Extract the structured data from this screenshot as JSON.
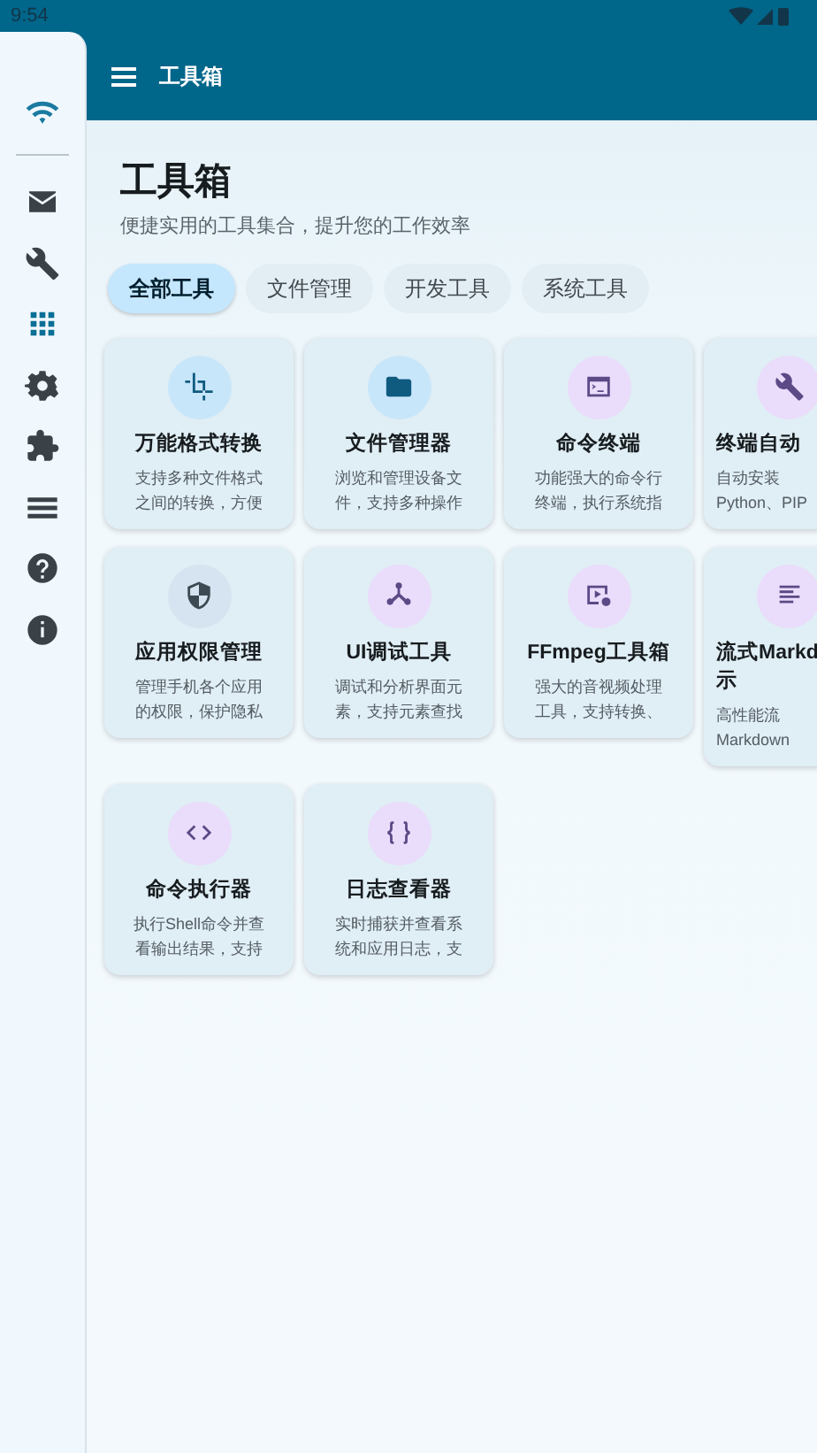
{
  "status_bar": {
    "time": "9:54"
  },
  "sidebar": {
    "items": [
      {
        "selected": false,
        "kind": "logo"
      },
      {
        "selected": false,
        "kind": "item"
      },
      {
        "selected": false,
        "kind": "item"
      },
      {
        "selected": true,
        "kind": "item"
      },
      {
        "selected": false,
        "kind": "item"
      },
      {
        "selected": false,
        "kind": "item"
      },
      {
        "selected": false,
        "kind": "item"
      },
      {
        "selected": false,
        "kind": "item"
      },
      {
        "selected": false,
        "kind": "item"
      }
    ]
  },
  "app_bar": {
    "title": "工具箱"
  },
  "header": {
    "title": "工具箱",
    "subtitle": "便捷实用的工具集合，提升您的工作效率"
  },
  "chips": [
    {
      "label": "全部工具",
      "selected": true
    },
    {
      "label": "文件管理",
      "selected": false
    },
    {
      "label": "开发工具",
      "selected": false
    },
    {
      "label": "系统工具",
      "selected": false
    }
  ],
  "tools": [
    {
      "kind": "full",
      "title_lines": [
        "万能格式转换"
      ],
      "desc_lines": [
        "支持多种文件格式",
        "之间的转换，方便"
      ]
    },
    {
      "kind": "full",
      "title_lines": [
        "文件管理器"
      ],
      "desc_lines": [
        "浏览和管理设备文",
        "件，支持多种操作"
      ]
    },
    {
      "kind": "full",
      "title_lines": [
        "命令终端"
      ],
      "desc_lines": [
        "功能强大的命令行",
        "终端，执行系统指"
      ]
    },
    {
      "kind": "partial",
      "title_lines": [
        "终端自动"
      ],
      "desc_lines": [
        "自动安装",
        "Python、PIP"
      ]
    },
    {
      "kind": "full",
      "title_lines": [
        "应用权限管理"
      ],
      "desc_lines": [
        "管理手机各个应用",
        "的权限，保护隐私"
      ]
    },
    {
      "kind": "full",
      "title_lines": [
        "UI调试工具"
      ],
      "desc_lines": [
        "调试和分析界面元",
        "素，支持元素查找"
      ]
    },
    {
      "kind": "full",
      "title_lines": [
        "FFmpeg工具箱"
      ],
      "desc_lines": [
        "强大的音视频处理",
        "工具，支持转换、"
      ]
    },
    {
      "kind": "partial",
      "title_lines": [
        "流式Markd",
        "示"
      ],
      "desc_lines": [
        "高性能流",
        "Markdown"
      ]
    },
    {
      "kind": "full",
      "title_lines": [
        "命令执行器"
      ],
      "desc_lines": [
        "执行Shell命令并查",
        "看输出结果，支持"
      ]
    },
    {
      "kind": "full",
      "title_lines": [
        "日志查看器"
      ],
      "desc_lines": [
        "实时捕获并查看系",
        "统和应用日志，支"
      ]
    }
  ]
}
